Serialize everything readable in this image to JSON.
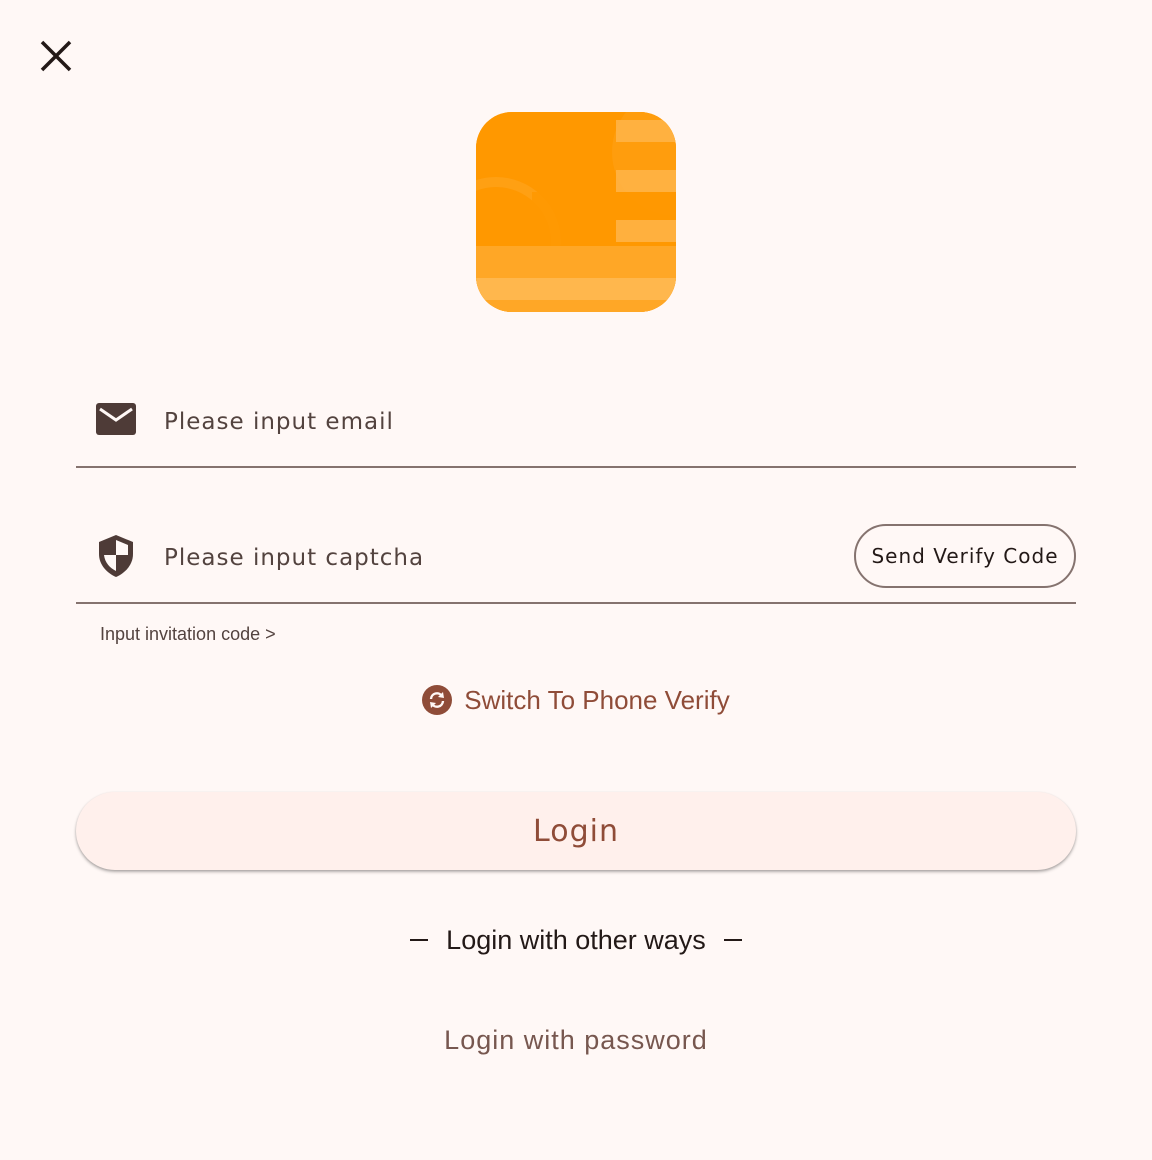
{
  "header": {
    "close_icon": "close-icon"
  },
  "logo": {
    "icon": "app-logo",
    "color": "#ff9800"
  },
  "form": {
    "email": {
      "icon": "mail-icon",
      "placeholder": "Please input email",
      "value": ""
    },
    "captcha": {
      "icon": "shield-icon",
      "placeholder": "Please input captcha",
      "value": "",
      "send_code_label": "Send Verify Code"
    },
    "invitation_label": "Input invitation code >"
  },
  "switch_verify": {
    "icon": "sync-icon",
    "label": "Switch To Phone Verify"
  },
  "login": {
    "label": "Login"
  },
  "other_ways": {
    "label": "Login with other ways"
  },
  "password_login": {
    "label": "Login with password"
  },
  "colors": {
    "background": "#fff8f6",
    "accent": "#8f4c38",
    "outline": "#85736f",
    "button_bg": "#fff0ec"
  }
}
